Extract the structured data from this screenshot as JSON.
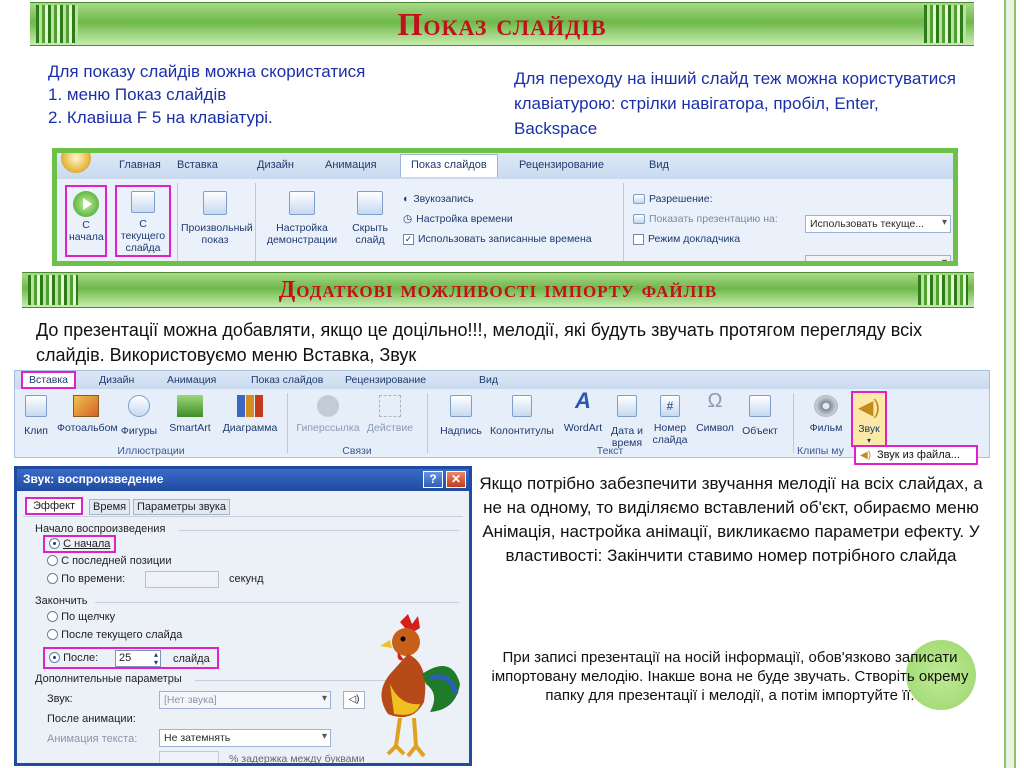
{
  "title1": "Показ слайдів",
  "intro": {
    "lead": "Для показу слайдів можна скористатися",
    "items": [
      "1.   меню Показ слайдів",
      "2.   Клавіша F 5 на клавіатурі."
    ],
    "right": "Для переходу на інший слайд теж можна користуватися клавіатурою: стрілки навігатора, пробіл,  Enter,  Backspace"
  },
  "ribbon1": {
    "tabs": [
      "Главная",
      "Вставка",
      "Дизайн",
      "Анимация",
      "Показ слайдов",
      "Рецензирование",
      "Вид"
    ],
    "btn_from_start": "С начала",
    "btn_from_current": "С текущего слайда",
    "btn_custom": "Произвольный показ",
    "btn_setup": "Настройка демонстрации",
    "btn_hide": "Скрыть слайд",
    "chk_record": "Звукозапись",
    "chk_timing": "Настройка времени",
    "chk_use_timings": "Использовать записанные времена",
    "lbl_resolution": "Разрешение:",
    "val_resolution": "Использовать текуще...",
    "lbl_show_on": "Показать презентацию на:",
    "lbl_presenter": "Режим докладчика"
  },
  "title2": "Додаткові можливості імпорту файлів",
  "para1": "До презентації можна добавляти, якщо це доцільно!!!, мелодії, які будуть звучать протягом  перегляду всіх слайдів. Використовуємо  меню  Вставка, Звук",
  "ribbon2": {
    "tabs": [
      "Вставка",
      "Дизайн",
      "Анимация",
      "Показ слайдов",
      "Рецензирование",
      "Вид"
    ],
    "buttons": [
      "Клип",
      "Фотоальбом",
      "Фигуры",
      "SmartArt",
      "Диаграмма",
      "Гиперссылка",
      "Действие",
      "Надпись",
      "Колонтитулы",
      "WordArt",
      "Дата и время",
      "Номер слайда",
      "Символ",
      "Объект",
      "Фильм",
      "Звук"
    ],
    "groups": [
      "Иллюстрации",
      "Связи",
      "Текст",
      "Клипы му"
    ],
    "sound_from_file": "Звук из файла..."
  },
  "dialog": {
    "title": "Звук: воспроизведение",
    "tabs": [
      "Эффект",
      "Время",
      "Параметры звука"
    ],
    "start_group": "Начало воспроизведения",
    "r_from_start": "С начала",
    "r_from_last": "С последней позиции",
    "r_by_time": "По времени:",
    "seconds": "секунд",
    "stop_group": "Закончить",
    "r_on_click": "По щелчку",
    "r_after_current": "После текущего слайда",
    "r_after": "После:",
    "after_value": "25",
    "slides": "слайда",
    "extra_group": "Дополнительные параметры",
    "lbl_sound": "Звук:",
    "val_sound": "[Нет звука]",
    "lbl_after_anim": "После анимации:",
    "val_after_anim": "Не затемнять",
    "lbl_anim_text": "Анимация текста:",
    "delay_label": "% задержка между буквами"
  },
  "para2": "Якщо потрібно забезпечити звучання мелодії на всіх слайдах, а не на одному, то виділяємо вставлений об'єкт,  обираємо меню Анімація, настройка анімації, викликаємо  параметри ефекту. У властивості: Закінчити ставимо номер  потрібного слайда",
  "para3": "При записі презентації на носій інформації, обов'язково  записати імпортовану мелодію. Інакше вона не буде звучать. Створіть окрему папку для презентації і мелодії, а потім імпортуйте її."
}
